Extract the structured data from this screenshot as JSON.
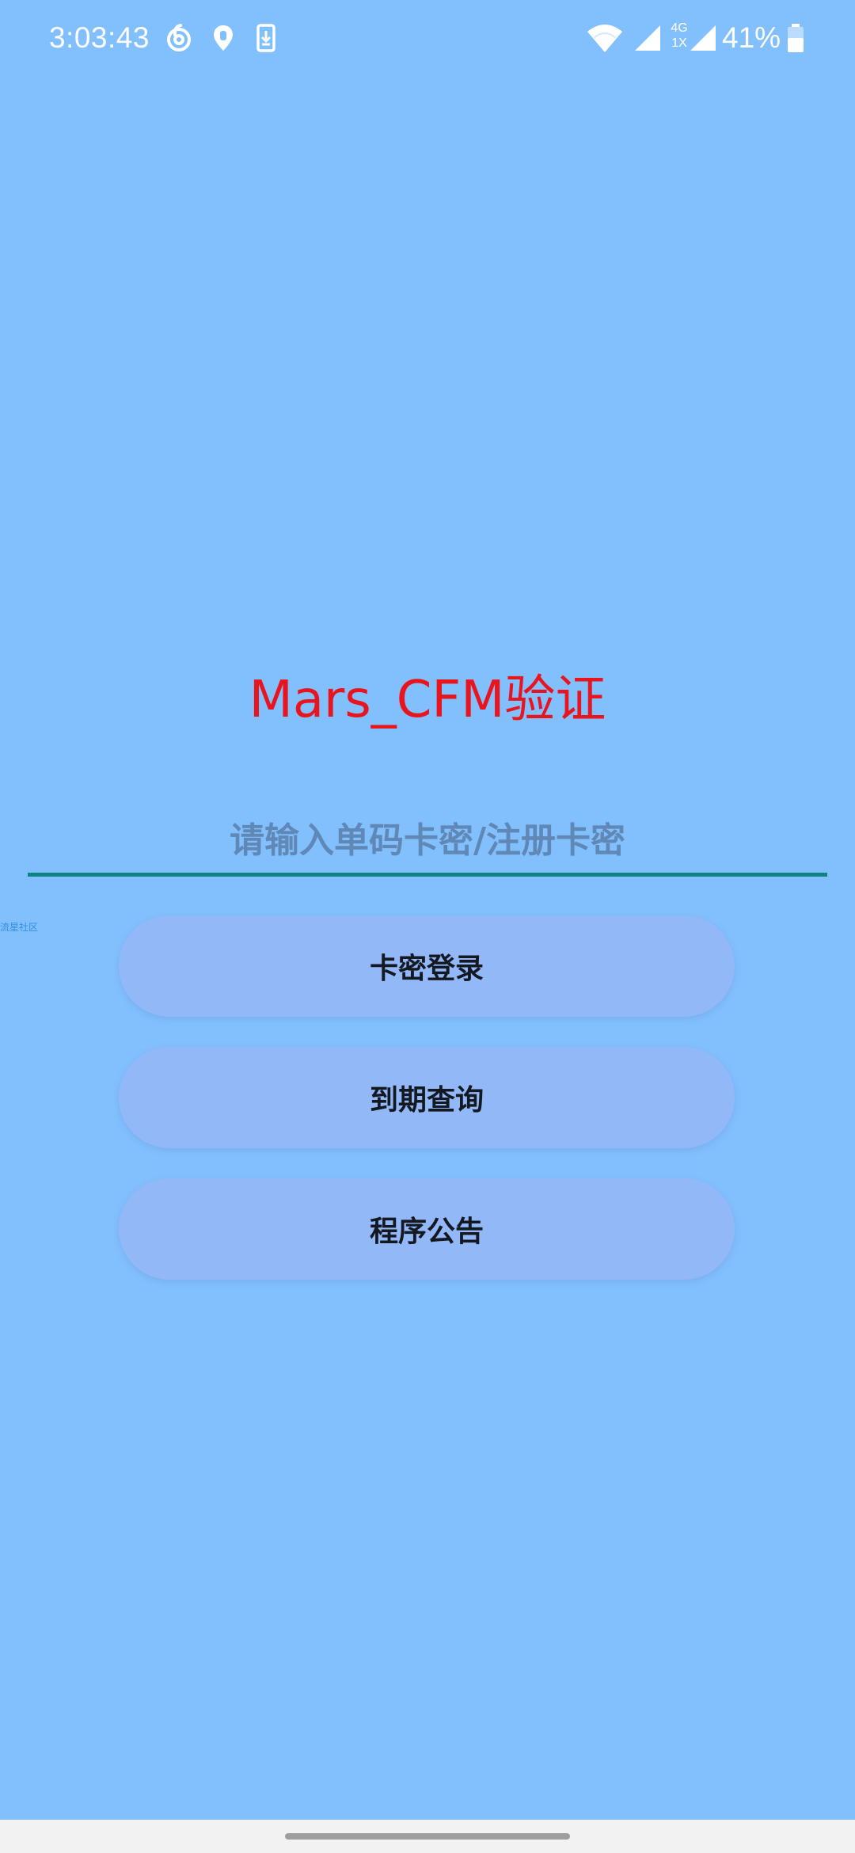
{
  "status_bar": {
    "time": "3:03:43",
    "network_type_top": "4G",
    "network_type_bottom": "1X",
    "battery_percent": "41%",
    "icons": [
      "netease-music-icon",
      "location-pin-icon",
      "download-icon",
      "wifi-icon",
      "cell-signal-icon",
      "cell-signal-2-icon",
      "battery-icon"
    ]
  },
  "main": {
    "title": "Mars_CFM验证",
    "card_input": {
      "value": "",
      "placeholder": "请输入单码卡密/注册卡密"
    },
    "watermark": "流星社区",
    "buttons": {
      "login": "卡密登录",
      "expiry_query": "到期查询",
      "announcement": "程序公告"
    }
  },
  "colors": {
    "background": "#82BFFD",
    "title": "#E8141E",
    "input_underline": "#0F8383",
    "button_bg": "#92B8F7"
  }
}
